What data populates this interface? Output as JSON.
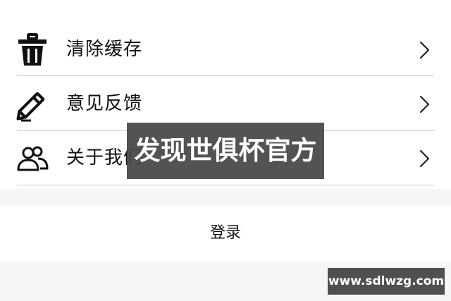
{
  "menu": {
    "items": [
      {
        "label": "清除缓存",
        "icon": "trash-icon"
      },
      {
        "label": "意见反馈",
        "icon": "pencil-icon"
      },
      {
        "label": "关于我们",
        "icon": "users-icon"
      }
    ],
    "chevron_icon": "chevron-right-icon"
  },
  "login": {
    "label": "登录"
  },
  "watermark": {
    "center_text": "发现世俱杯官方",
    "url_text": "www.sdlwzg.com"
  },
  "colors": {
    "divider": "#c9c9c9",
    "band_background": "#f5f6f8",
    "watermark_background": "#464646",
    "text": "#111111"
  }
}
